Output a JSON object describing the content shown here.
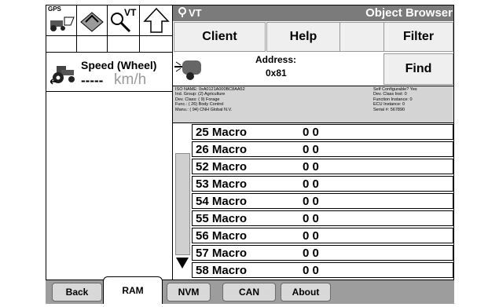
{
  "left_panel": {
    "toolbar_gps_label": "GPS",
    "toolbar_vt_label": "VT",
    "speed_title": "Speed (Wheel)",
    "speed_value": "-----",
    "speed_unit": "km/h"
  },
  "window": {
    "vt_label": "VT",
    "title": "Object Browser"
  },
  "header": {
    "client_label": "Client",
    "help_label": "Help",
    "filter_label": "Filter",
    "find_label": "Find",
    "address_label": "Address:",
    "address_value": "0x81"
  },
  "info": {
    "left": [
      "ISO NAME: 0xA0121A000BC8AA52",
      "Ind. Group: (2) Agriculture",
      "Dev. Class: ( 9) Forage",
      "Func.: ( 26) Body Control",
      "Manu.: ( 94) CNH Global N.V."
    ],
    "right": [
      "Self Configurable? Yes",
      "Dev. Class Inst: 0",
      "Function Instance: 0",
      "ECU Instance: 0",
      "Serial #: 567890"
    ]
  },
  "list": {
    "rows": [
      {
        "name": "25 Macro",
        "value": "0 0"
      },
      {
        "name": "26 Macro",
        "value": "0 0"
      },
      {
        "name": "52 Macro",
        "value": "0 0"
      },
      {
        "name": "53 Macro",
        "value": "0 0"
      },
      {
        "name": "54 Macro",
        "value": "0 0"
      },
      {
        "name": "55 Macro",
        "value": "0 0"
      },
      {
        "name": "56 Macro",
        "value": "0 0"
      },
      {
        "name": "57 Macro",
        "value": "0 0"
      },
      {
        "name": "58 Macro",
        "value": "0 0"
      }
    ]
  },
  "tabs": {
    "back": "Back",
    "ram": "RAM",
    "nvm": "NVM",
    "can": "CAN",
    "about": "About"
  },
  "colors": {
    "titlebar": "#7b7b7b",
    "button": "#efefef",
    "info_bg": "#d4d4d4",
    "tabbar": "#9d9d9d"
  }
}
